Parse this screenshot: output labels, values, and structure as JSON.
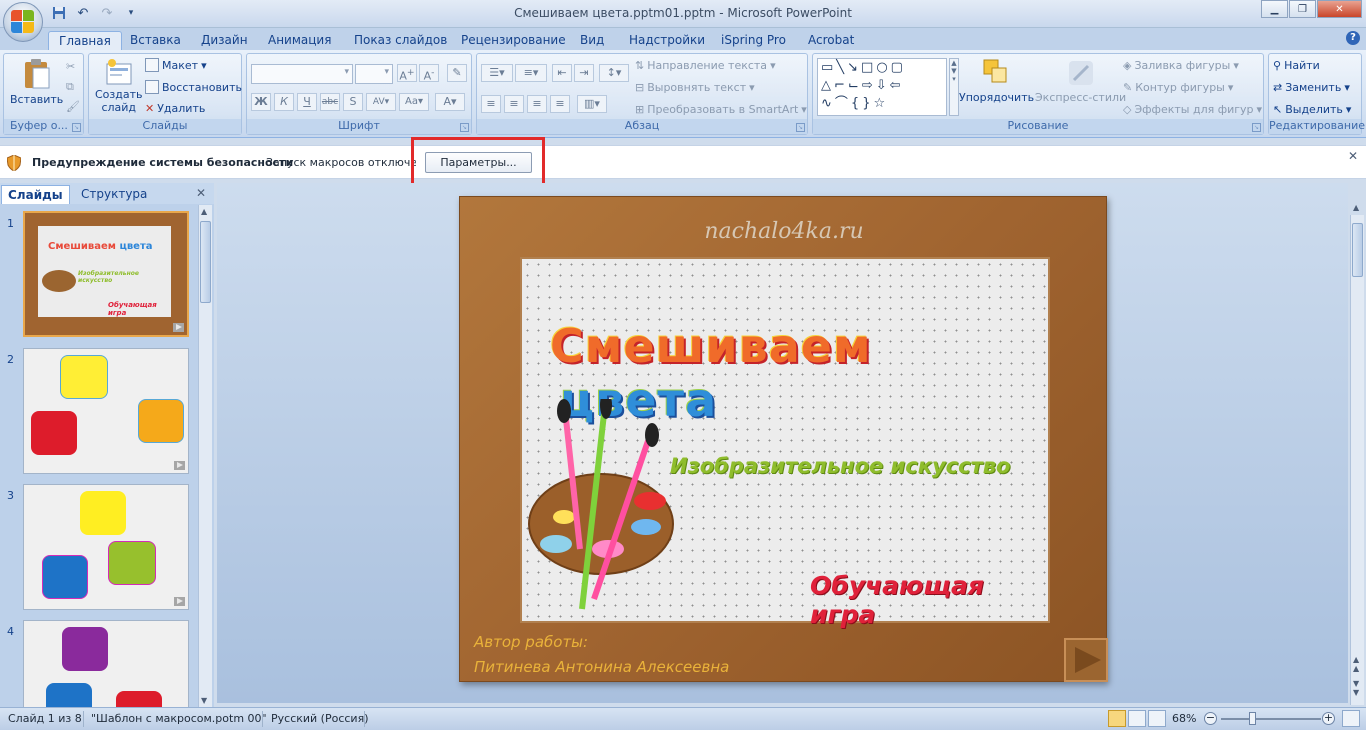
{
  "window": {
    "title": "Смешиваем цвета.pptm01.pptm - Microsoft PowerPoint",
    "quick_access": [
      "save-icon",
      "undo-icon",
      "redo-icon",
      "customize-icon"
    ]
  },
  "ribbon_tabs": [
    "Главная",
    "Вставка",
    "Дизайн",
    "Анимация",
    "Показ слайдов",
    "Рецензирование",
    "Вид",
    "Надстройки",
    "iSpring Pro",
    "Acrobat"
  ],
  "ribbon": {
    "clipboard": {
      "label": "Буфер о...",
      "paste": "Вставить"
    },
    "slides": {
      "label": "Слайды",
      "new_slide": "Создать",
      "new_slide2": "слайд",
      "layout": "Макет",
      "reset": "Восстановить",
      "delete": "Удалить"
    },
    "font": {
      "label": "Шрифт"
    },
    "paragraph": {
      "label": "Абзац",
      "text_direction": "Направление текста",
      "align_text": "Выровнять текст",
      "convert_smartart": "Преобразовать в SmartArt"
    },
    "drawing": {
      "label": "Рисование",
      "arrange": "Упорядочить",
      "quick_styles": "Экспресс-стили",
      "fill": "Заливка фигуры",
      "outline": "Контур фигуры",
      "effects": "Эффекты для фигур"
    },
    "editing": {
      "label": "Редактирование",
      "find": "Найти",
      "replace": "Заменить",
      "select": "Выделить"
    }
  },
  "security_bar": {
    "title": "Предупреждение системы безопасности",
    "message": "Запуск макросов отключен",
    "button": "Параметры..."
  },
  "left_panel": {
    "tabs": [
      "Слайды",
      "Структура"
    ],
    "thumbnails": [
      "1",
      "2",
      "3",
      "4"
    ]
  },
  "slide": {
    "site": "nachalo4ka.ru",
    "title_word1": "Смешиваем",
    "title_word2": "цвета",
    "subtitle": "Изобразительное искусство",
    "game": "Обучающая игра",
    "author_label": "Автор работы:",
    "author_name": "Питинева Антонина Алексеевна"
  },
  "status_bar": {
    "slide_info": "Слайд 1 из 8",
    "template": "\"Шаблон с макросом.potm 00\"",
    "language": "Русский (Россия)",
    "zoom": "68%"
  },
  "colors": {
    "accent": "#15428b",
    "frame": "#a06430",
    "highlight": "#e22a2a"
  }
}
